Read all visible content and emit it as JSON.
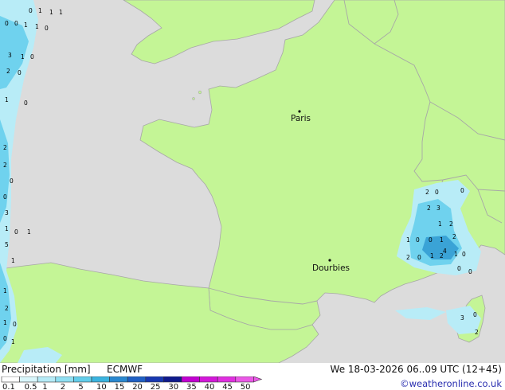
{
  "map": {
    "colors": {
      "sea": "#dcdcdc",
      "land": "#c4f596",
      "border": "#a7a7a7",
      "precip_light": "#b8ecf7",
      "precip_mid": "#6fd2ee",
      "precip_strong": "#3aa3d6"
    },
    "cities": [
      {
        "name": "Paris"
      },
      {
        "name": "Dourbies"
      }
    ],
    "precip_values": [
      "0",
      "1",
      "1",
      "1",
      "0",
      "0",
      "1",
      "1",
      "0",
      "3",
      "1",
      "0",
      "2",
      "0",
      "1",
      "0",
      "2",
      "2",
      "0",
      "0",
      "3",
      "1",
      "0",
      "1",
      "5",
      "1",
      "1",
      "2",
      "1",
      "0",
      "0",
      "1",
      "2",
      "0",
      "0",
      "2",
      "3",
      "1",
      "2",
      "1",
      "0",
      "0",
      "1",
      "2",
      "2",
      "0",
      "1",
      "2",
      "4",
      "1",
      "0",
      "0",
      "0",
      "3",
      "0",
      "2"
    ]
  },
  "footer": {
    "title": "Precipitation [mm]",
    "model": "ECMWF",
    "valid": "We 18-03-2026 06..09 UTC (12+45)",
    "credit": "©weatheronline.co.uk"
  },
  "legend": {
    "ticks": [
      "0.1",
      "0.5",
      "1",
      "2",
      "5",
      "10",
      "15",
      "20",
      "25",
      "30",
      "35",
      "40",
      "45",
      "50"
    ],
    "colors": [
      "#ffffff",
      "#d9f6fb",
      "#b6ebf7",
      "#8fdff2",
      "#62cdea",
      "#3ab3df",
      "#2a88d0",
      "#1f5fc4",
      "#1838b0",
      "#0f1a8c",
      "#c100d0",
      "#d318d9",
      "#e02fe0",
      "#ea58e6"
    ]
  }
}
